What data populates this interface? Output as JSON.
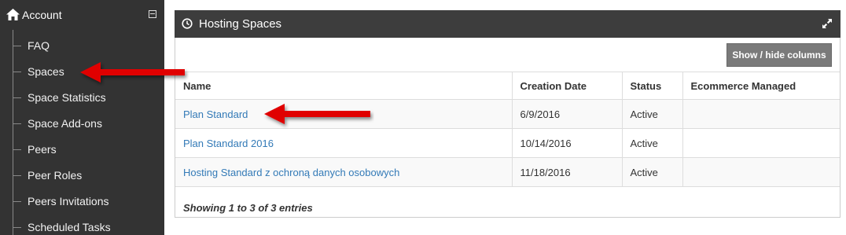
{
  "sidebar": {
    "title": "Account",
    "items": [
      {
        "label": "FAQ"
      },
      {
        "label": "Spaces"
      },
      {
        "label": "Space Statistics"
      },
      {
        "label": "Space Add-ons"
      },
      {
        "label": "Peers"
      },
      {
        "label": "Peer Roles"
      },
      {
        "label": "Peers Invitations"
      },
      {
        "label": "Scheduled Tasks"
      }
    ]
  },
  "panel": {
    "title": "Hosting Spaces",
    "show_hide_label": "Show / hide columns",
    "columns": [
      "Name",
      "Creation Date",
      "Status",
      "Ecommerce Managed"
    ],
    "rows": [
      {
        "name": "Plan Standard",
        "date": "6/9/2016",
        "status": "Active",
        "ecommerce": ""
      },
      {
        "name": "Plan Standard 2016",
        "date": "10/14/2016",
        "status": "Active",
        "ecommerce": ""
      },
      {
        "name": "Hosting Standard z ochroną danych osobowych",
        "date": "11/18/2016",
        "status": "Active",
        "ecommerce": ""
      }
    ],
    "footer": "Showing 1 to 3 of 3 entries"
  },
  "colors": {
    "sidebar_bg": "#333333",
    "panel_heading_bg": "#3d3d3d",
    "link": "#337ab7",
    "button_bg": "#7a7a7a",
    "annotation_arrow": "#e00000"
  }
}
